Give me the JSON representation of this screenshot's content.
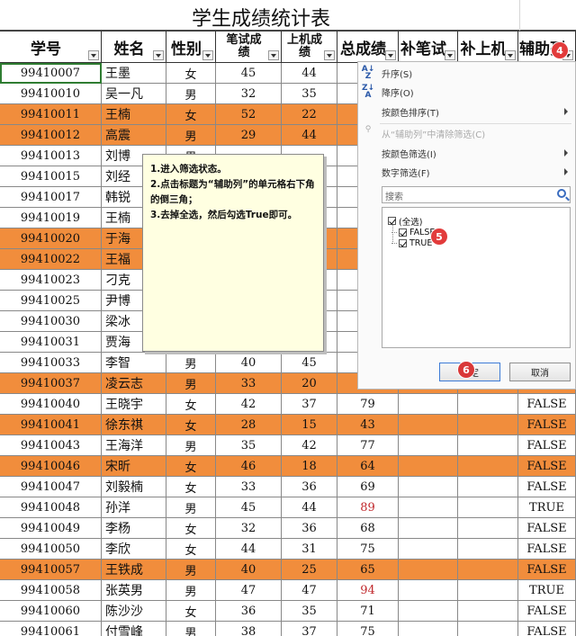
{
  "title": "学生成绩统计表",
  "headers": [
    {
      "label": "学号"
    },
    {
      "label": "姓名"
    },
    {
      "label": "性别"
    },
    {
      "label": "笔试成\n绩"
    },
    {
      "label": "上机成\n绩"
    },
    {
      "label": "总成绩"
    },
    {
      "label": "补笔试"
    },
    {
      "label": "补上机"
    },
    {
      "label": "辅助列"
    }
  ],
  "rows": [
    {
      "id": "99410007",
      "name": "王墨",
      "gender": "女",
      "written": "45",
      "machine": "44",
      "total": "",
      "aux": "",
      "orange": false
    },
    {
      "id": "99410010",
      "name": "吴一凡",
      "gender": "男",
      "written": "32",
      "machine": "35",
      "total": "",
      "aux": "",
      "orange": false
    },
    {
      "id": "99410011",
      "name": "王楠",
      "gender": "女",
      "written": "52",
      "machine": "22",
      "total": "",
      "aux": "",
      "orange": true
    },
    {
      "id": "99410012",
      "name": "高震",
      "gender": "男",
      "written": "29",
      "machine": "44",
      "total": "",
      "aux": "",
      "orange": true
    },
    {
      "id": "99410013",
      "name": "刘博",
      "gender": "男",
      "written": "",
      "machine": "",
      "total": "",
      "aux": "",
      "orange": false
    },
    {
      "id": "99410015",
      "name": "刘经",
      "gender": "",
      "written": "",
      "machine": "",
      "total": "",
      "aux": "",
      "orange": false
    },
    {
      "id": "99410017",
      "name": "韩锐",
      "gender": "",
      "written": "",
      "machine": "",
      "total": "",
      "aux": "",
      "orange": false
    },
    {
      "id": "99410019",
      "name": "王楠",
      "gender": "",
      "written": "",
      "machine": "",
      "total": "",
      "aux": "",
      "orange": false
    },
    {
      "id": "99410020",
      "name": "于海",
      "gender": "",
      "written": "",
      "machine": "",
      "total": "",
      "aux": "",
      "orange": true
    },
    {
      "id": "99410022",
      "name": "王福",
      "gender": "",
      "written": "",
      "machine": "",
      "total": "",
      "aux": "",
      "orange": true
    },
    {
      "id": "99410023",
      "name": "刁克",
      "gender": "",
      "written": "",
      "machine": "",
      "total": "",
      "aux": "",
      "orange": false
    },
    {
      "id": "99410025",
      "name": "尹博",
      "gender": "",
      "written": "",
      "machine": "",
      "total": "",
      "aux": "",
      "orange": false
    },
    {
      "id": "99410030",
      "name": "梁冰",
      "gender": "",
      "written": "",
      "machine": "",
      "total": "",
      "aux": "",
      "orange": false
    },
    {
      "id": "99410031",
      "name": "贾海",
      "gender": "",
      "written": "",
      "machine": "",
      "total": "",
      "aux": "",
      "orange": false
    },
    {
      "id": "99410033",
      "name": "李智",
      "gender": "男",
      "written": "40",
      "machine": "45",
      "total": "",
      "aux": "",
      "orange": false
    },
    {
      "id": "99410037",
      "name": "凌云志",
      "gender": "男",
      "written": "33",
      "machine": "20",
      "total": "",
      "aux": "",
      "orange": true
    },
    {
      "id": "99410040",
      "name": "王晓宇",
      "gender": "女",
      "written": "42",
      "machine": "37",
      "total": "79",
      "aux": "FALSE",
      "orange": false
    },
    {
      "id": "99410041",
      "name": "徐东祺",
      "gender": "女",
      "written": "28",
      "machine": "15",
      "total": "43",
      "aux": "FALSE",
      "orange": true
    },
    {
      "id": "99410043",
      "name": "王海洋",
      "gender": "男",
      "written": "35",
      "machine": "42",
      "total": "77",
      "aux": "FALSE",
      "orange": false
    },
    {
      "id": "99410046",
      "name": "宋昕",
      "gender": "女",
      "written": "46",
      "machine": "18",
      "total": "64",
      "aux": "FALSE",
      "orange": true
    },
    {
      "id": "99410047",
      "name": "刘毅楠",
      "gender": "女",
      "written": "33",
      "machine": "36",
      "total": "69",
      "aux": "FALSE",
      "orange": false
    },
    {
      "id": "99410048",
      "name": "孙洋",
      "gender": "男",
      "written": "45",
      "machine": "44",
      "total": "89",
      "aux": "TRUE",
      "orange": false,
      "red": true
    },
    {
      "id": "99410049",
      "name": "李杨",
      "gender": "女",
      "written": "32",
      "machine": "36",
      "total": "68",
      "aux": "FALSE",
      "orange": false
    },
    {
      "id": "99410050",
      "name": "李欣",
      "gender": "女",
      "written": "44",
      "machine": "31",
      "total": "75",
      "aux": "FALSE",
      "orange": false
    },
    {
      "id": "99410057",
      "name": "王铁成",
      "gender": "男",
      "written": "40",
      "machine": "25",
      "total": "65",
      "aux": "FALSE",
      "orange": true
    },
    {
      "id": "99410058",
      "name": "张英男",
      "gender": "男",
      "written": "47",
      "machine": "47",
      "total": "94",
      "aux": "TRUE",
      "orange": false,
      "red": true
    },
    {
      "id": "99410060",
      "name": "陈沙沙",
      "gender": "女",
      "written": "36",
      "machine": "35",
      "total": "71",
      "aux": "FALSE",
      "orange": false
    },
    {
      "id": "99410061",
      "name": "付雪峰",
      "gender": "男",
      "written": "38",
      "machine": "37",
      "total": "75",
      "aux": "FALSE",
      "orange": false
    }
  ],
  "note": {
    "lines": [
      "1.进入筛选状态。",
      "2.点击标题为“辅助列”的单元格右下角的倒三角；",
      "3.去掉全选，然后勾选True即可。"
    ]
  },
  "filter_menu": {
    "sort_asc": "升序(S)",
    "sort_desc": "降序(O)",
    "sort_by_color": "按颜色排序(T)",
    "clear_filter": "从“辅助列”中清除筛选(C)",
    "filter_by_color": "按颜色筛选(I)",
    "number_filter": "数字筛选(F)",
    "search_placeholder": "搜索",
    "items": [
      {
        "label": "(全选)",
        "checked": true
      },
      {
        "label": "FALSE",
        "checked": true
      },
      {
        "label": "TRUE",
        "checked": true
      }
    ],
    "ok_label": "确定",
    "cancel_label": "取消"
  },
  "markers": [
    "4",
    "5",
    "6"
  ],
  "colors": {
    "orange_row": "#f18d3c",
    "note_bg": "#ffffe1",
    "marker": "#e23b3b",
    "red_text": "#c0282c"
  }
}
